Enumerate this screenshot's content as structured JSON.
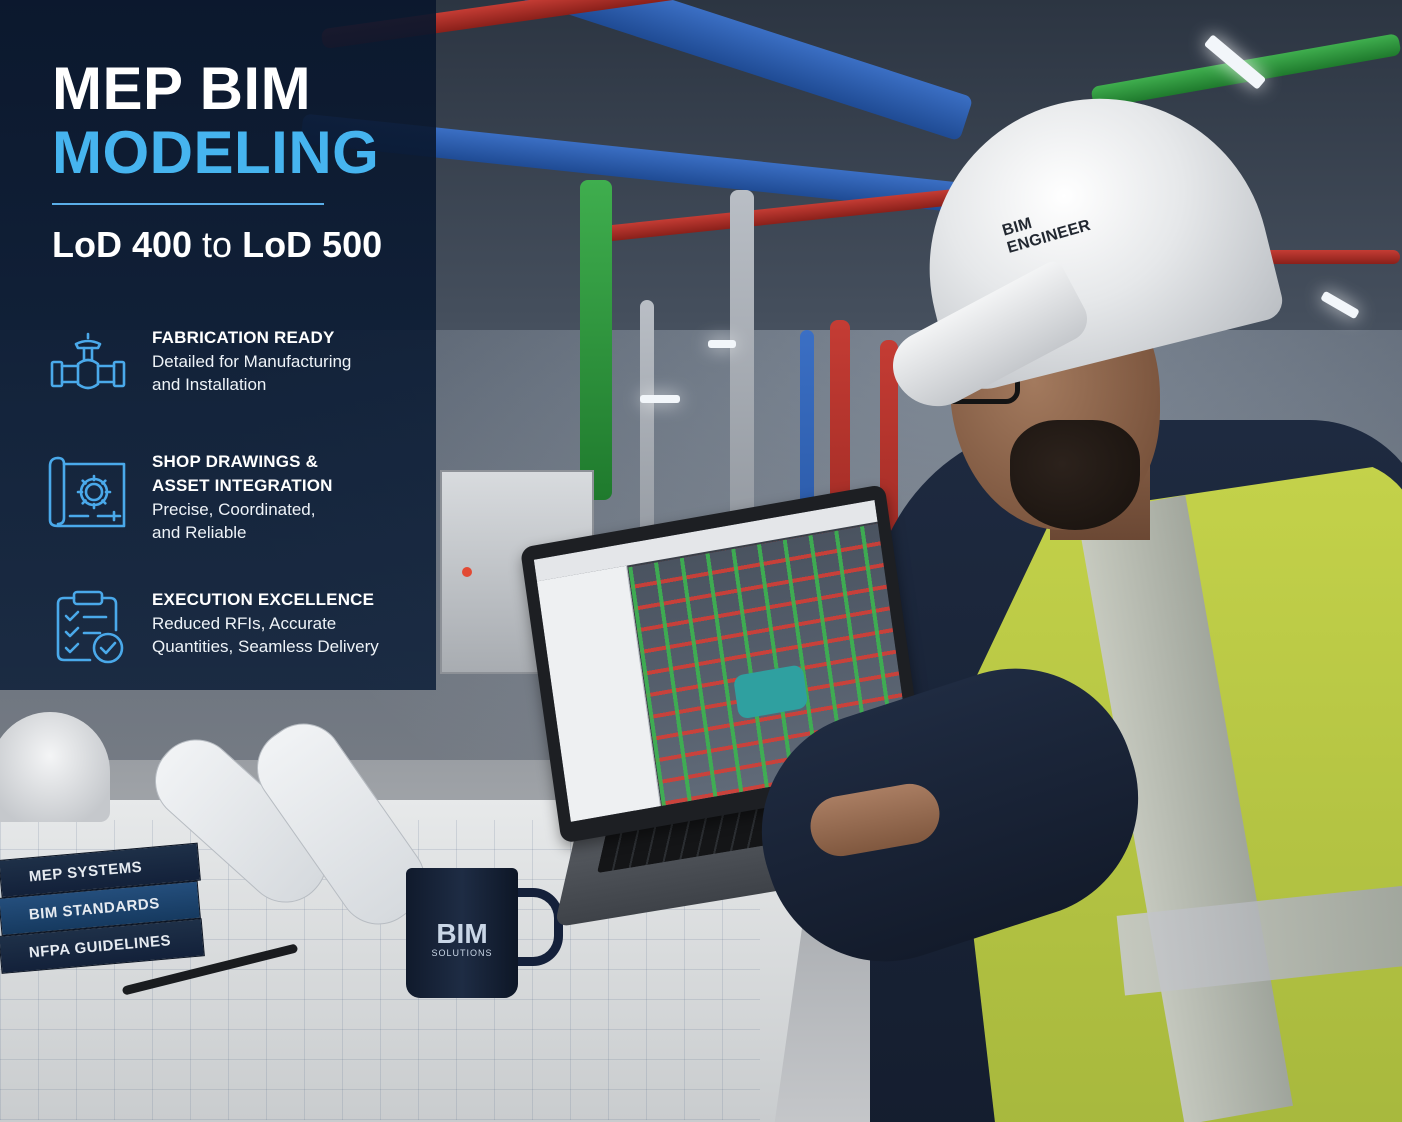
{
  "title": {
    "line1": "MEP BIM",
    "line2": "MODELING",
    "accent_color": "#46b4ef"
  },
  "subtitle": {
    "part1": "LoD 400",
    "connector": " to ",
    "part2": "LoD 500"
  },
  "features": [
    {
      "icon": "pipe-valve-icon",
      "heading": "FABRICATION READY",
      "desc_line1": "Detailed for Manufacturing",
      "desc_line2": "and Installation"
    },
    {
      "icon": "blueprint-gear-icon",
      "heading_line1": "SHOP DRAWINGS &",
      "heading_line2": "ASSET INTEGRATION",
      "desc_line1": "Precise, Coordinated,",
      "desc_line2": "and Reliable"
    },
    {
      "icon": "clipboard-check-icon",
      "heading": "EXECUTION EXCELLENCE",
      "desc_line1": "Reduced RFIs, Accurate",
      "desc_line2": "Quantities, Seamless Delivery"
    }
  ],
  "scene": {
    "hardhat_label": "BIM ENGINEER",
    "books": [
      "MEP SYSTEMS",
      "BIM STANDARDS",
      "NFPA GUIDELINES"
    ],
    "mug_title": "BIM",
    "mug_subtitle": "SOLUTIONS"
  }
}
